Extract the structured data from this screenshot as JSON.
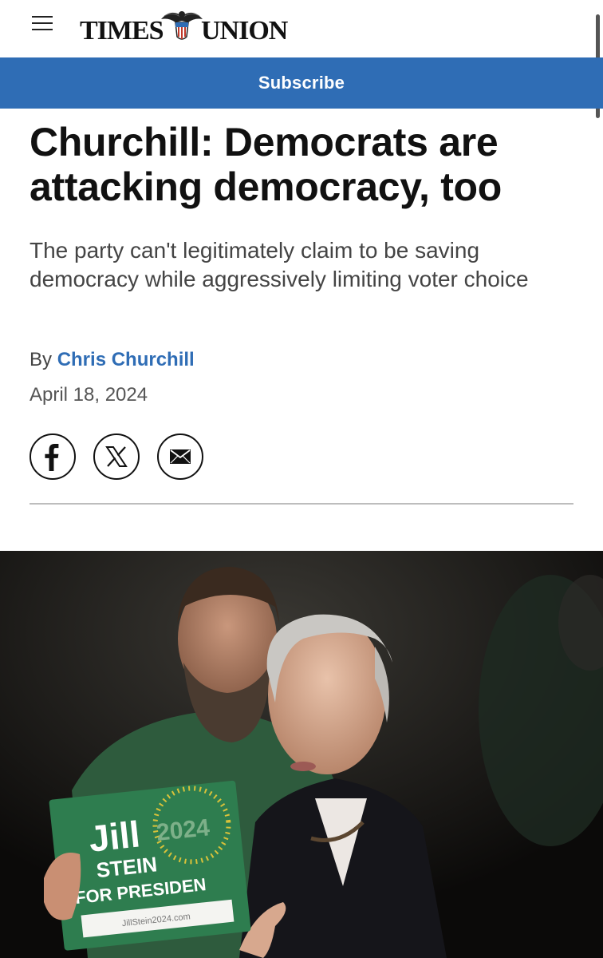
{
  "header": {
    "logo_left": "TIMES",
    "logo_right": "UNION",
    "menu_icon": "hamburger-menu-icon"
  },
  "subscribe": {
    "label": "Subscribe"
  },
  "article": {
    "headline": "Churchill: Democrats are attacking democracy, too",
    "dek": "The party can't legitimately claim to be saving democracy while aggressively limiting voter choice",
    "byline_prefix": "By",
    "author": "Chris Churchill",
    "date": "April 18, 2024"
  },
  "share": {
    "icons": [
      "facebook-icon",
      "x-icon",
      "email-icon"
    ]
  },
  "photo": {
    "sign_name_1": "Jill",
    "sign_year": "2024",
    "sign_name_2": "STEIN",
    "sign_line_3": "FOR PRESIDEN",
    "sign_url": "JillStein2024.com"
  },
  "colors": {
    "brand_blue": "#2f6db5",
    "text": "#111111",
    "muted": "#444444"
  }
}
